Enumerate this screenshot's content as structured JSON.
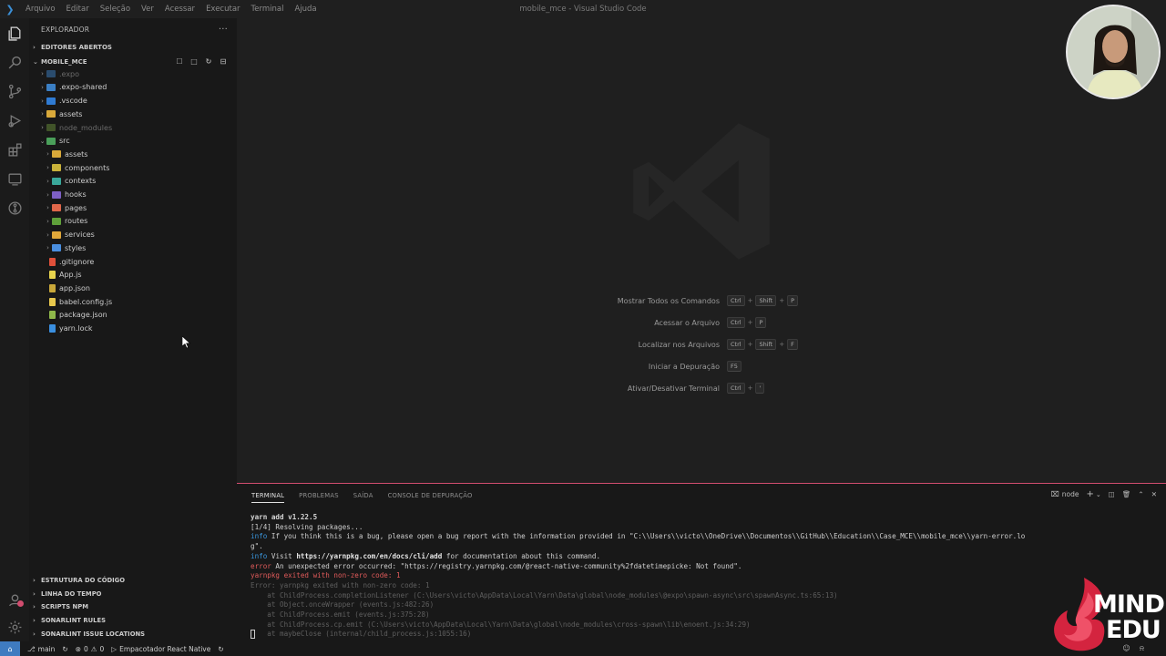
{
  "titlebar": {
    "menu": [
      "Arquivo",
      "Editar",
      "Seleção",
      "Ver",
      "Acessar",
      "Executar",
      "Terminal",
      "Ajuda"
    ],
    "window_title": "mobile_mce - Visual Studio Code"
  },
  "sidebar": {
    "title": "EXPLORADOR",
    "more": "···",
    "open_editors": "EDITORES ABERTOS",
    "project": "MOBILE_MCE",
    "tree": [
      {
        "label": ".expo",
        "type": "folder",
        "indent": 0,
        "dim": true,
        "color": "#3b7fc4"
      },
      {
        "label": ".expo-shared",
        "type": "folder",
        "indent": 0,
        "dim": false,
        "color": "#3b7fc4"
      },
      {
        "label": ".vscode",
        "type": "folder",
        "indent": 0,
        "dim": false,
        "color": "#2f7bd3"
      },
      {
        "label": "assets",
        "type": "folder",
        "indent": 0,
        "dim": false,
        "color": "#d9a93a"
      },
      {
        "label": "node_modules",
        "type": "folder",
        "indent": 0,
        "dim": true,
        "color": "#6a8f3a"
      },
      {
        "label": "src",
        "type": "folder-open",
        "indent": 0,
        "dim": false,
        "color": "#4a9f5a"
      },
      {
        "label": "assets",
        "type": "folder",
        "indent": 1,
        "dim": false,
        "color": "#d9a93a"
      },
      {
        "label": "components",
        "type": "folder",
        "indent": 1,
        "dim": false,
        "color": "#c9b23a"
      },
      {
        "label": "contexts",
        "type": "folder",
        "indent": 1,
        "dim": false,
        "color": "#3aa89a"
      },
      {
        "label": "hooks",
        "type": "folder",
        "indent": 1,
        "dim": false,
        "color": "#7d5fc4"
      },
      {
        "label": "pages",
        "type": "folder",
        "indent": 1,
        "dim": false,
        "color": "#e0674a"
      },
      {
        "label": "routes",
        "type": "folder",
        "indent": 1,
        "dim": false,
        "color": "#5fa03a"
      },
      {
        "label": "services",
        "type": "folder",
        "indent": 1,
        "dim": false,
        "color": "#e0a73a"
      },
      {
        "label": "styles",
        "type": "folder",
        "indent": 1,
        "dim": false,
        "color": "#4a8fe0"
      },
      {
        "label": ".gitignore",
        "type": "file",
        "indent": 0,
        "dim": false,
        "color": "#e0503a"
      },
      {
        "label": "App.js",
        "type": "file",
        "indent": 0,
        "dim": false,
        "color": "#e8d44d"
      },
      {
        "label": "app.json",
        "type": "file",
        "indent": 0,
        "dim": false,
        "color": "#c9a83a"
      },
      {
        "label": "babel.config.js",
        "type": "file",
        "indent": 0,
        "dim": false,
        "color": "#e8c84d"
      },
      {
        "label": "package.json",
        "type": "file",
        "indent": 0,
        "dim": false,
        "color": "#8fb84a"
      },
      {
        "label": "yarn.lock",
        "type": "file",
        "indent": 0,
        "dim": false,
        "color": "#3a8fe0"
      }
    ],
    "bottom_sections": [
      "ESTRUTURA DO CÓDIGO",
      "LINHA DO TEMPO",
      "SCRIPTS NPM",
      "SONARLINT RULES",
      "SONARLINT ISSUE LOCATIONS"
    ]
  },
  "editor": {
    "shortcuts": [
      {
        "label": "Mostrar Todos os Comandos",
        "keys": [
          "Ctrl",
          "Shift",
          "P"
        ]
      },
      {
        "label": "Acessar o Arquivo",
        "keys": [
          "Ctrl",
          "P"
        ]
      },
      {
        "label": "Localizar nos Arquivos",
        "keys": [
          "Ctrl",
          "Shift",
          "F"
        ]
      },
      {
        "label": "Iniciar a Depuração",
        "keys": [
          "F5"
        ]
      },
      {
        "label": "Ativar/Desativar Terminal",
        "keys": [
          "Ctrl",
          "'"
        ]
      }
    ]
  },
  "panel": {
    "tabs": [
      "TERMINAL",
      "PROBLEMAS",
      "SAÍDA",
      "CONSOLE DE DEPURAÇÃO"
    ],
    "shell": "node",
    "terminal": {
      "l1": "yarn add v1.22.5",
      "l2": "[1/4] Resolving packages...",
      "l3_tag": "info",
      "l3_text": " If you think this is a bug, please open a bug report with the information provided in \"C:\\\\Users\\\\victo\\\\OneDrive\\\\Documentos\\\\GitHub\\\\Education\\\\Case_MCE\\\\mobile_mce\\\\yarn-error.lo",
      "l4": "g\".",
      "l5_tag": "info",
      "l5_a": " Visit ",
      "l5_link": "https://yarnpkg.com/en/docs/cli/add",
      "l5_b": " for documentation about this command.",
      "l6_tag": "error",
      "l6_text": " An unexpected error occurred: \"https://registry.yarnpkg.com/@react-native-community%2fdatetimepicke: Not found\".",
      "l7": "yarnpkg exited with non-zero code: 1",
      "l8": "Error: yarnpkg exited with non-zero code: 1",
      "l9": "    at ChildProcess.completionListener (C:\\Users\\victo\\AppData\\Local\\Yarn\\Data\\global\\node_modules\\@expo\\spawn-async\\src\\spawnAsync.ts:65:13)",
      "l10": "    at Object.onceWrapper (events.js:482:26)",
      "l11": "    at ChildProcess.emit (events.js:375:28)",
      "l12": "    at ChildProcess.cp.emit (C:\\Users\\victo\\AppData\\Local\\Yarn\\Data\\global\\node_modules\\cross-spawn\\lib\\enoent.js:34:29)",
      "l13": "    at maybeClose (internal/child_process.js:1055:16)"
    }
  },
  "statusbar": {
    "branch": "main",
    "errors": "0",
    "warnings": "0",
    "run_label": "Empacotador React Native"
  },
  "brand": {
    "line1": "MIND",
    "line2": "EDU"
  }
}
